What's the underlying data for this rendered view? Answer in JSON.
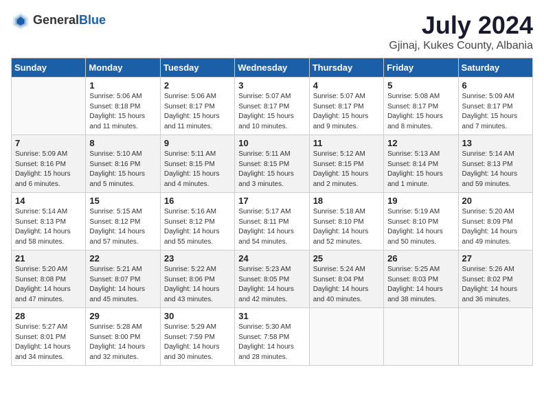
{
  "logo": {
    "general": "General",
    "blue": "Blue"
  },
  "title": "July 2024",
  "location": "Gjinaj, Kukes County, Albania",
  "days_of_week": [
    "Sunday",
    "Monday",
    "Tuesday",
    "Wednesday",
    "Thursday",
    "Friday",
    "Saturday"
  ],
  "weeks": [
    [
      {
        "day": "",
        "info": ""
      },
      {
        "day": "1",
        "info": "Sunrise: 5:06 AM\nSunset: 8:18 PM\nDaylight: 15 hours\nand 11 minutes."
      },
      {
        "day": "2",
        "info": "Sunrise: 5:06 AM\nSunset: 8:17 PM\nDaylight: 15 hours\nand 11 minutes."
      },
      {
        "day": "3",
        "info": "Sunrise: 5:07 AM\nSunset: 8:17 PM\nDaylight: 15 hours\nand 10 minutes."
      },
      {
        "day": "4",
        "info": "Sunrise: 5:07 AM\nSunset: 8:17 PM\nDaylight: 15 hours\nand 9 minutes."
      },
      {
        "day": "5",
        "info": "Sunrise: 5:08 AM\nSunset: 8:17 PM\nDaylight: 15 hours\nand 8 minutes."
      },
      {
        "day": "6",
        "info": "Sunrise: 5:09 AM\nSunset: 8:17 PM\nDaylight: 15 hours\nand 7 minutes."
      }
    ],
    [
      {
        "day": "7",
        "info": "Sunrise: 5:09 AM\nSunset: 8:16 PM\nDaylight: 15 hours\nand 6 minutes."
      },
      {
        "day": "8",
        "info": "Sunrise: 5:10 AM\nSunset: 8:16 PM\nDaylight: 15 hours\nand 5 minutes."
      },
      {
        "day": "9",
        "info": "Sunrise: 5:11 AM\nSunset: 8:15 PM\nDaylight: 15 hours\nand 4 minutes."
      },
      {
        "day": "10",
        "info": "Sunrise: 5:11 AM\nSunset: 8:15 PM\nDaylight: 15 hours\nand 3 minutes."
      },
      {
        "day": "11",
        "info": "Sunrise: 5:12 AM\nSunset: 8:15 PM\nDaylight: 15 hours\nand 2 minutes."
      },
      {
        "day": "12",
        "info": "Sunrise: 5:13 AM\nSunset: 8:14 PM\nDaylight: 15 hours\nand 1 minute."
      },
      {
        "day": "13",
        "info": "Sunrise: 5:14 AM\nSunset: 8:13 PM\nDaylight: 14 hours\nand 59 minutes."
      }
    ],
    [
      {
        "day": "14",
        "info": "Sunrise: 5:14 AM\nSunset: 8:13 PM\nDaylight: 14 hours\nand 58 minutes."
      },
      {
        "day": "15",
        "info": "Sunrise: 5:15 AM\nSunset: 8:12 PM\nDaylight: 14 hours\nand 57 minutes."
      },
      {
        "day": "16",
        "info": "Sunrise: 5:16 AM\nSunset: 8:12 PM\nDaylight: 14 hours\nand 55 minutes."
      },
      {
        "day": "17",
        "info": "Sunrise: 5:17 AM\nSunset: 8:11 PM\nDaylight: 14 hours\nand 54 minutes."
      },
      {
        "day": "18",
        "info": "Sunrise: 5:18 AM\nSunset: 8:10 PM\nDaylight: 14 hours\nand 52 minutes."
      },
      {
        "day": "19",
        "info": "Sunrise: 5:19 AM\nSunset: 8:10 PM\nDaylight: 14 hours\nand 50 minutes."
      },
      {
        "day": "20",
        "info": "Sunrise: 5:20 AM\nSunset: 8:09 PM\nDaylight: 14 hours\nand 49 minutes."
      }
    ],
    [
      {
        "day": "21",
        "info": "Sunrise: 5:20 AM\nSunset: 8:08 PM\nDaylight: 14 hours\nand 47 minutes."
      },
      {
        "day": "22",
        "info": "Sunrise: 5:21 AM\nSunset: 8:07 PM\nDaylight: 14 hours\nand 45 minutes."
      },
      {
        "day": "23",
        "info": "Sunrise: 5:22 AM\nSunset: 8:06 PM\nDaylight: 14 hours\nand 43 minutes."
      },
      {
        "day": "24",
        "info": "Sunrise: 5:23 AM\nSunset: 8:05 PM\nDaylight: 14 hours\nand 42 minutes."
      },
      {
        "day": "25",
        "info": "Sunrise: 5:24 AM\nSunset: 8:04 PM\nDaylight: 14 hours\nand 40 minutes."
      },
      {
        "day": "26",
        "info": "Sunrise: 5:25 AM\nSunset: 8:03 PM\nDaylight: 14 hours\nand 38 minutes."
      },
      {
        "day": "27",
        "info": "Sunrise: 5:26 AM\nSunset: 8:02 PM\nDaylight: 14 hours\nand 36 minutes."
      }
    ],
    [
      {
        "day": "28",
        "info": "Sunrise: 5:27 AM\nSunset: 8:01 PM\nDaylight: 14 hours\nand 34 minutes."
      },
      {
        "day": "29",
        "info": "Sunrise: 5:28 AM\nSunset: 8:00 PM\nDaylight: 14 hours\nand 32 minutes."
      },
      {
        "day": "30",
        "info": "Sunrise: 5:29 AM\nSunset: 7:59 PM\nDaylight: 14 hours\nand 30 minutes."
      },
      {
        "day": "31",
        "info": "Sunrise: 5:30 AM\nSunset: 7:58 PM\nDaylight: 14 hours\nand 28 minutes."
      },
      {
        "day": "",
        "info": ""
      },
      {
        "day": "",
        "info": ""
      },
      {
        "day": "",
        "info": ""
      }
    ]
  ]
}
